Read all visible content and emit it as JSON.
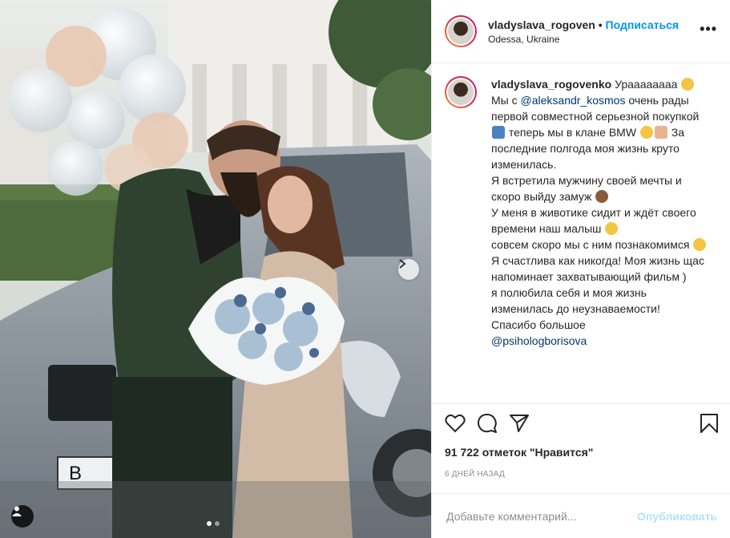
{
  "post": {
    "username": "vladyslava_rogoven",
    "separator": "•",
    "follow_label": "Подписаться",
    "location": "Odessa, Ukraine",
    "more_label": "•••"
  },
  "caption": {
    "username": "vladyslava_rogovenko",
    "line1": "Ураааааааа",
    "line2_prefix": "Мы с ",
    "mention1": "@aleksandr_kosmos",
    "line2_rest": " очень рады первой совместной серьезной покупкой",
    "line3": " теперь мы в клане BMW",
    "line4": " За последние полгода моя жизнь круто изменилась.",
    "line5": "Я встретила мужчину своей мечты и скоро выйду замуж",
    "line6": "У меня в животике сидит и ждёт своего времени наш малыш",
    "line7": "совсем скоро мы с ним познакомимся",
    "line8": "Я счастлива как никогда! Моя жизнь щас напоминает захватывающий фильм )",
    "line9": "я полюбила себя и моя жизнь изменилась до неузнаваемости!",
    "line10": "Спасибо большое",
    "mention2": "@psihologborisova"
  },
  "stats": {
    "likes": "91 722 отметок \"Нравится\"",
    "date": "6 дней назад"
  },
  "comment": {
    "placeholder": "Добавьте комментарий...",
    "publish_label": "Опубликовать"
  },
  "icons": {
    "like": "heart-icon",
    "comment": "comment-icon",
    "share": "share-icon",
    "save": "bookmark-icon",
    "next": "chevron-right-icon",
    "tag": "user-tag-icon"
  },
  "colors": {
    "accent": "#0095f6",
    "mention": "#00376b",
    "publish_disabled": "#b2dffc"
  }
}
